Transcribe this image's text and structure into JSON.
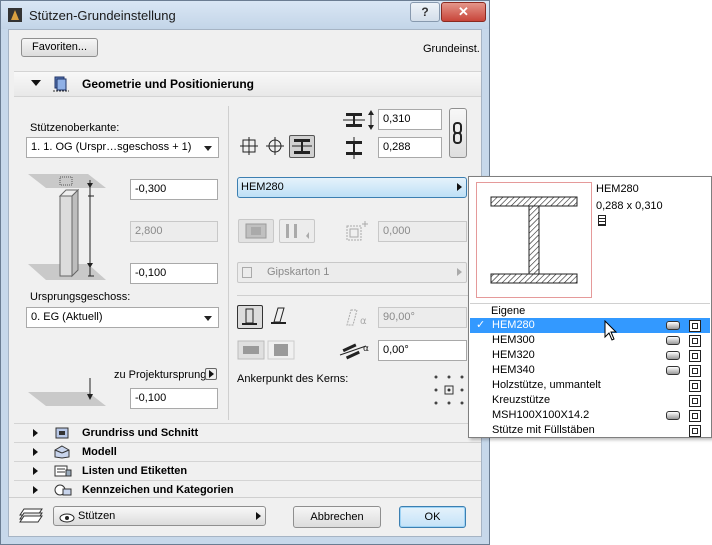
{
  "window": {
    "title": "Stützen-Grundeinstellung",
    "help_label": "?",
    "close_label": "✕"
  },
  "top": {
    "favorites_label": "Favoriten...",
    "default_label": "Grundeinst."
  },
  "geometry": {
    "header": "Geometrie und Positionierung",
    "top_link_label": "Stützenoberkante:",
    "top_link_value": "1. 1. OG (Urspr…sgeschoss + 1)",
    "top_offset": "-0,300",
    "height": "2,800",
    "bottom_offset": "-0,100",
    "home_story_label": "Ursprungsgeschoss:",
    "home_story_value": "0. EG (Aktuell)",
    "to_project_zero_label": "zu Projekturs­prung",
    "project_zero_value": "-0,100",
    "width_value": "0,310",
    "depth_value": "0,288",
    "profile_value": "HEM280",
    "veneer_value": "0,000",
    "veneer_type_value": "Gipskarton 1",
    "angle_value": "90,00°",
    "rotation_value": "0,00°",
    "anchor_label": "Ankerpunkt des Kerns:"
  },
  "sections": [
    {
      "label": "Grundriss und Schnitt"
    },
    {
      "label": "Modell"
    },
    {
      "label": "Listen und Etiketten"
    },
    {
      "label": "Kennzeichen und Kategorien"
    }
  ],
  "bottom": {
    "layer_value": "Stützen",
    "cancel_label": "Abbrechen",
    "ok_label": "OK"
  },
  "popup": {
    "preview_name": "HEM280",
    "preview_size": "0,288 x 0,310",
    "preview_icon": "column-profile-icon",
    "group_label": "Eigene",
    "items": [
      {
        "label": "HEM280",
        "selected": true,
        "profile_icon": true
      },
      {
        "label": "HEM300",
        "selected": false,
        "profile_icon": true
      },
      {
        "label": "HEM320",
        "selected": false,
        "profile_icon": true
      },
      {
        "label": "HEM340",
        "selected": false,
        "profile_icon": true
      },
      {
        "label": "Holzstütze, ummantelt",
        "selected": false,
        "profile_icon": false
      },
      {
        "label": "Kreuzstütze",
        "selected": false,
        "profile_icon": false
      },
      {
        "label": "MSH100X100X14.2",
        "selected": false,
        "profile_icon": true
      },
      {
        "label": "Stütze mit Füllstäben",
        "selected": false,
        "profile_icon": false
      }
    ],
    "check_mark": "✓",
    "selection_color": "#3399ff"
  }
}
